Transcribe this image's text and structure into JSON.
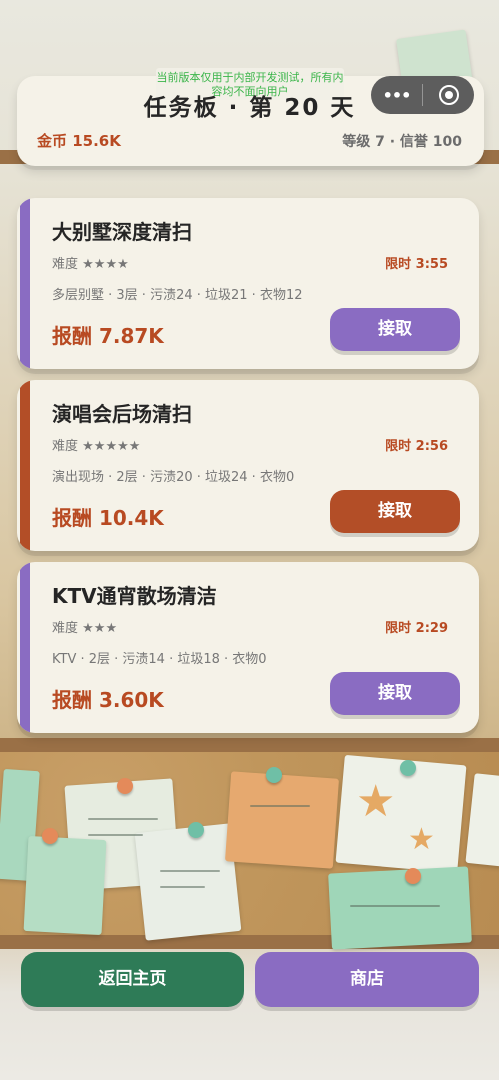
{
  "dev_notice": "当前版本仅用于内部开发测试，所有内容均不面向用户",
  "header": {
    "title": "任务板 · 第 20 天",
    "gold": "金币 15.6K",
    "stats": "等级 7 · 信誉 100"
  },
  "capsule": {
    "more_icon": "more-dots-icon",
    "close_icon": "mini-program-close-icon"
  },
  "colors": {
    "purple": "#8a6cc2",
    "rust": "#b34e27",
    "green": "#2e7b57",
    "reward": "#b84a22"
  },
  "tasks": [
    {
      "name": "大别墅深度清扫",
      "difficulty": "难度 ★★★★",
      "limit": "限时 3:55",
      "meta": "多层别墅 · 3层 · 污渍24 · 垃圾21 · 衣物12",
      "reward": "报酬 7.87K",
      "accept": "接取",
      "accent": "#8a6cc2"
    },
    {
      "name": "演唱会后场清扫",
      "difficulty": "难度 ★★★★★",
      "limit": "限时 2:56",
      "meta": "演出现场 · 2层 · 污渍20 · 垃圾24 · 衣物0",
      "reward": "报酬 10.4K",
      "accept": "接取",
      "accent": "#b34e27"
    },
    {
      "name": "KTV通宵散场清洁",
      "difficulty": "难度 ★★★",
      "limit": "限时 2:29",
      "meta": "KTV · 2层 · 污渍14 · 垃圾18 · 衣物0",
      "reward": "报酬 3.60K",
      "accept": "接取",
      "accent": "#8a6cc2"
    }
  ],
  "bottom": {
    "home": "返回主页",
    "shop": "商店"
  }
}
